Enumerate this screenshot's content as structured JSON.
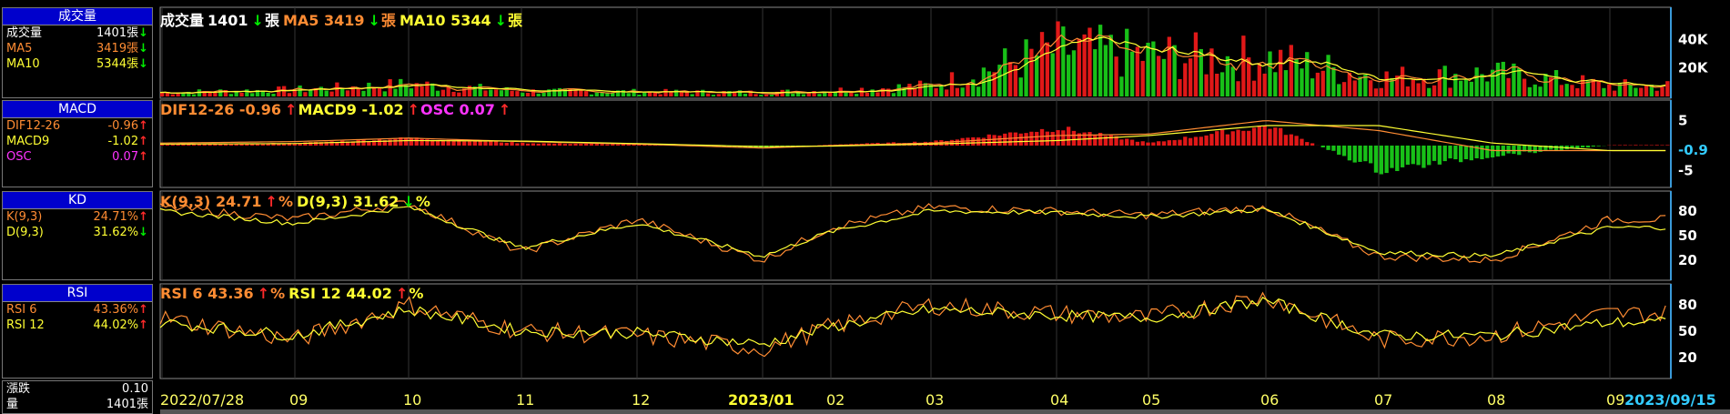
{
  "sidebar": {
    "volume": {
      "title": "成交量",
      "rows": [
        {
          "label": "成交量",
          "value": "1401張",
          "arrow": "↓",
          "color": "#ffffff"
        },
        {
          "label": "MA5",
          "value": "3419張",
          "arrow": "↓",
          "color": "#ff8c33"
        },
        {
          "label": "MA10",
          "value": "5344張",
          "arrow": "↓",
          "color": "#ffff33"
        }
      ]
    },
    "macd": {
      "title": "MACD",
      "rows": [
        {
          "label": "DIF12-26",
          "value": "-0.96",
          "arrow": "↑",
          "color": "#ff8c33"
        },
        {
          "label": "MACD9",
          "value": "-1.02",
          "arrow": "↑",
          "color": "#ffff33"
        },
        {
          "label": "OSC",
          "value": "0.07",
          "arrow": "↑",
          "color": "#ff33ff"
        }
      ]
    },
    "kd": {
      "title": "KD",
      "rows": [
        {
          "label": "K(9,3)",
          "value": "24.71%",
          "arrow": "↑",
          "color": "#ff8c33"
        },
        {
          "label": "D(9,3)",
          "value": "31.62%",
          "arrow": "↓",
          "color": "#ffff33"
        }
      ]
    },
    "rsi": {
      "title": "RSI",
      "rows": [
        {
          "label": "RSI 6",
          "value": "43.36%",
          "arrow": "↑",
          "color": "#ff8c33"
        },
        {
          "label": "RSI 12",
          "value": "44.02%",
          "arrow": "↑",
          "color": "#ffff33"
        }
      ]
    },
    "bottom": [
      {
        "label": "漲跌",
        "value": "0.10"
      },
      {
        "label": "量",
        "value": "1401張"
      }
    ]
  },
  "legends": {
    "volume": [
      {
        "text": "成交量",
        "color": "#ffffff"
      },
      {
        "text": "1401",
        "color": "#ffffff"
      },
      {
        "text": "↓",
        "color": "#00ee00"
      },
      {
        "text": "張",
        "color": "#ffffff"
      },
      {
        "text": "MA5 3419",
        "color": "#ff8c33"
      },
      {
        "text": "↓",
        "color": "#00ee00"
      },
      {
        "text": "張",
        "color": "#ff8c33"
      },
      {
        "text": "MA10 5344",
        "color": "#ffff33"
      },
      {
        "text": "↓",
        "color": "#00ee00"
      },
      {
        "text": "張",
        "color": "#ffff33"
      }
    ],
    "macd": [
      {
        "text": "DIF12-26 -0.96",
        "color": "#ff8c33"
      },
      {
        "text": "↑",
        "color": "#ff2a2a"
      },
      {
        "text": "MACD9 -1.02",
        "color": "#ffff33"
      },
      {
        "text": "↑",
        "color": "#ff2a2a"
      },
      {
        "text": "OSC 0.07",
        "color": "#ff33ff"
      },
      {
        "text": "↑",
        "color": "#ff2a2a"
      }
    ],
    "kd": [
      {
        "text": "K(9,3) 24.71",
        "color": "#ff8c33"
      },
      {
        "text": "↑",
        "color": "#ff2a2a"
      },
      {
        "text": "%",
        "color": "#ff8c33"
      },
      {
        "text": "D(9,3) 31.62",
        "color": "#ffff33"
      },
      {
        "text": "↓",
        "color": "#00ee00"
      },
      {
        "text": "%",
        "color": "#ffff33"
      }
    ],
    "rsi": [
      {
        "text": "RSI 6 43.36",
        "color": "#ff8c33"
      },
      {
        "text": "↑",
        "color": "#ff2a2a"
      },
      {
        "text": "%",
        "color": "#ff8c33"
      },
      {
        "text": "RSI 12 44.02",
        "color": "#ffff33"
      },
      {
        "text": "↑",
        "color": "#ff2a2a"
      },
      {
        "text": "%",
        "color": "#ffff33"
      }
    ]
  },
  "chart_data": [
    {
      "type": "bar",
      "title": "成交量",
      "x_labels": [
        "2022/07/28",
        "09",
        "10",
        "11",
        "12",
        "2023/01",
        "02",
        "03",
        "04",
        "05",
        "06",
        "07",
        "08",
        "09",
        "2023/09/15"
      ],
      "y_ticks": [
        "40K",
        "20K"
      ],
      "ylim": [
        0,
        60000
      ],
      "months": [
        8,
        9,
        10,
        11,
        12,
        1,
        2,
        3,
        4,
        5,
        6,
        7,
        8,
        9
      ],
      "monthly_volume": [
        3000,
        5000,
        9000,
        4000,
        3500,
        3000,
        4500,
        8000,
        35000,
        30000,
        28000,
        14000,
        17000,
        8000
      ],
      "series": [
        {
          "name": "成交量",
          "last": 1401
        },
        {
          "name": "MA5",
          "last": 3419
        },
        {
          "name": "MA10",
          "last": 5344
        }
      ]
    },
    {
      "type": "bar",
      "title": "MACD",
      "y_ticks": [
        "5",
        "-5"
      ],
      "current_label": "-0.9",
      "ylim": [
        -8,
        8
      ],
      "months": [
        8,
        9,
        10,
        11,
        12,
        1,
        2,
        3,
        4,
        5,
        6,
        7,
        8,
        9
      ],
      "dif": [
        0.5,
        0.8,
        1.5,
        0.8,
        0.3,
        -0.5,
        0,
        0.5,
        2,
        2.3,
        5,
        3,
        -1,
        -1
      ],
      "macd9": [
        0.3,
        0.4,
        1,
        0.9,
        0.4,
        -0.2,
        -0.1,
        0.3,
        1,
        2,
        4,
        4,
        0.5,
        -1
      ],
      "osc": [
        0.2,
        0.5,
        1.5,
        0.5,
        0.2,
        -0.5,
        0.2,
        0.8,
        3.5,
        0.5,
        4,
        -5,
        -2,
        0.1
      ],
      "series": [
        {
          "name": "DIF12-26",
          "last": -0.96
        },
        {
          "name": "MACD9",
          "last": -1.02
        },
        {
          "name": "OSC",
          "last": 0.07
        }
      ]
    },
    {
      "type": "line",
      "title": "KD",
      "y_ticks": [
        "80",
        "50",
        "20"
      ],
      "ylim": [
        0,
        100
      ],
      "months": [
        8,
        9,
        10,
        11,
        12,
        1,
        2,
        3,
        4,
        5,
        6,
        7,
        8,
        9
      ],
      "k": [
        85,
        70,
        90,
        30,
        70,
        20,
        60,
        85,
        80,
        75,
        85,
        25,
        20,
        70
      ],
      "d": [
        80,
        65,
        85,
        35,
        65,
        25,
        55,
        80,
        78,
        73,
        82,
        30,
        25,
        60
      ],
      "series": [
        {
          "name": "K(9,3)",
          "last": 24.71
        },
        {
          "name": "D(9,3)",
          "last": 31.62
        }
      ]
    },
    {
      "type": "line",
      "title": "RSI",
      "y_ticks": [
        "80",
        "50",
        "20"
      ],
      "ylim": [
        0,
        100
      ],
      "months": [
        8,
        9,
        10,
        11,
        12,
        1,
        2,
        3,
        4,
        5,
        6,
        7,
        8,
        9
      ],
      "rsi6": [
        65,
        40,
        80,
        50,
        45,
        30,
        55,
        80,
        70,
        65,
        90,
        40,
        45,
        70
      ],
      "rsi12": [
        60,
        45,
        75,
        50,
        48,
        35,
        55,
        75,
        68,
        65,
        85,
        45,
        45,
        60
      ],
      "series": [
        {
          "name": "RSI 6",
          "last": 43.36
        },
        {
          "name": "RSI 12",
          "last": 44.02
        }
      ]
    }
  ]
}
